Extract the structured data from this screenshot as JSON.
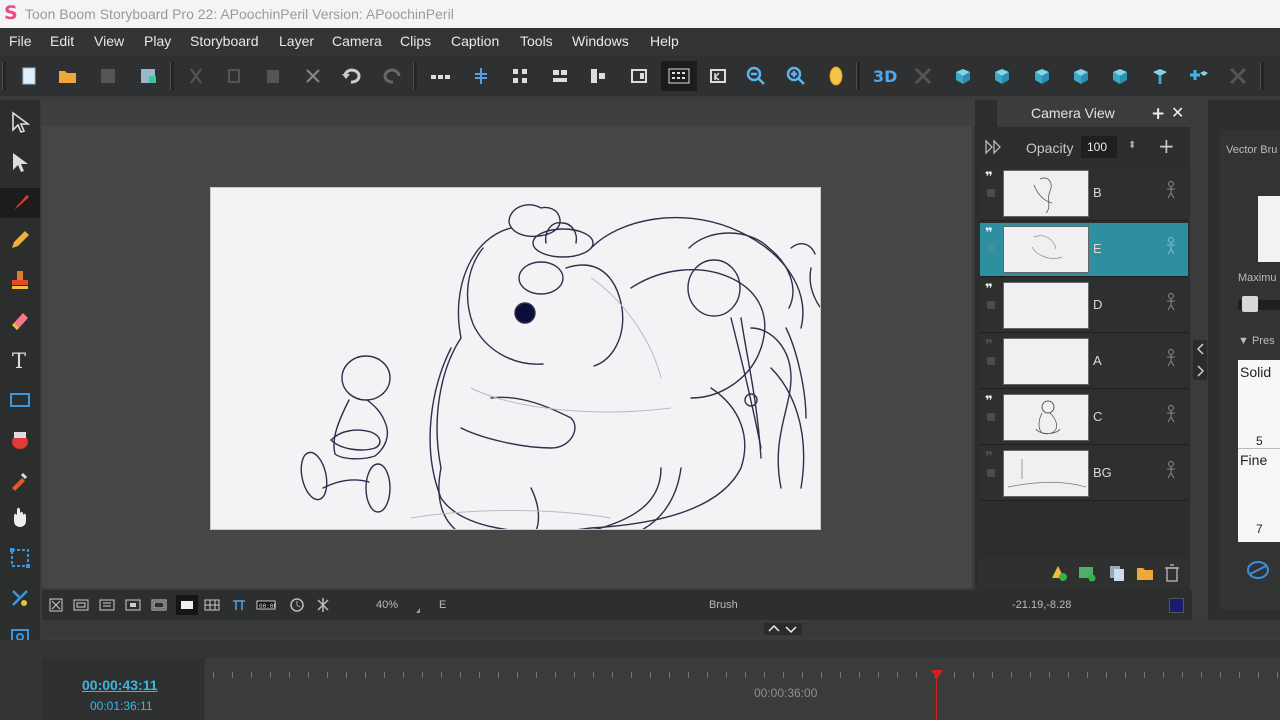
{
  "window": {
    "title": "Toon Boom Storyboard Pro 22: APoochinPeril Version: APoochinPeril",
    "logo_letter": "S"
  },
  "menu": [
    "File",
    "Edit",
    "View",
    "Play",
    "Storyboard",
    "Layer",
    "Camera",
    "Clips",
    "Caption",
    "Tools",
    "Windows",
    "Help"
  ],
  "stage": {
    "zoom": "40%",
    "current_layer": "E",
    "tool": "Brush",
    "coordinates": "-21.19,-8.28"
  },
  "camera_view": {
    "title": "Camera View",
    "opacity_label": "Opacity",
    "opacity_value": "100",
    "layers": [
      {
        "name": "B",
        "selected": false,
        "visible": true
      },
      {
        "name": "E",
        "selected": true,
        "visible": true
      },
      {
        "name": "D",
        "selected": false,
        "visible": true
      },
      {
        "name": "A",
        "selected": false,
        "visible": false
      },
      {
        "name": "C",
        "selected": false,
        "visible": true
      },
      {
        "name": "BG",
        "selected": false,
        "visible": false
      }
    ]
  },
  "tool_properties": {
    "panel_label": "Vector Bru",
    "maximum_label": "Maximu",
    "presets_label": "Pres",
    "presets": [
      {
        "label": "Solid",
        "value": "5"
      },
      {
        "label": "Fine",
        "value": "7"
      }
    ]
  },
  "timeline": {
    "current_time": "00:00:43:11",
    "total_time": "00:01:36:11",
    "ruler_marker": "00:00:36:00"
  },
  "colors": {
    "accent": "#2d8fa0",
    "current_color": "#1a1a6e",
    "playhead": "#d42020"
  }
}
